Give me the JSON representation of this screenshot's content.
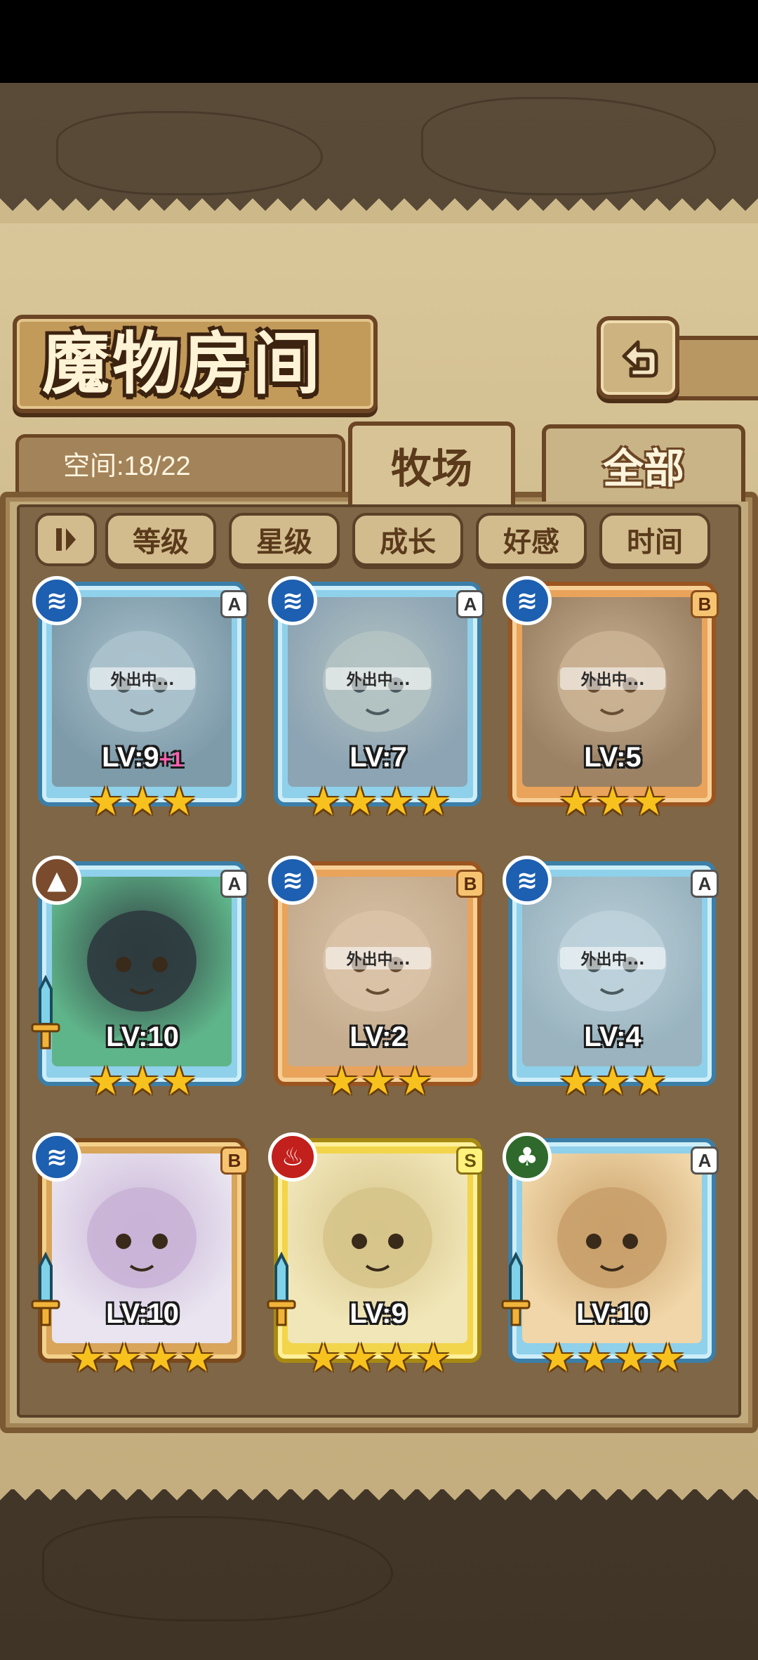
{
  "title": "魔物房间",
  "capacity": "空间:18/22",
  "tabs": {
    "active": "牧场",
    "inactive": "全部"
  },
  "sort_buttons": [
    "等级",
    "星级",
    "成长",
    "好感",
    "时间"
  ],
  "icons": {
    "back": "back-arrow-icon",
    "sort_toggle": "sort-order-icon"
  },
  "cards": [
    {
      "element": "water",
      "rank": "A",
      "level": "LV:9",
      "bonus": "+1",
      "stars": 3,
      "status": "外出中...",
      "weapon": false
    },
    {
      "element": "water",
      "rank": "A",
      "level": "LV:7",
      "bonus": "",
      "stars": 4,
      "status": "外出中...",
      "weapon": false
    },
    {
      "element": "water",
      "rank": "B",
      "level": "LV:5",
      "bonus": "",
      "stars": 3,
      "status": "外出中...",
      "weapon": false
    },
    {
      "element": "earth",
      "rank": "A",
      "level": "LV:10",
      "bonus": "",
      "stars": 3,
      "status": "",
      "weapon": true
    },
    {
      "element": "water",
      "rank": "B",
      "level": "LV:2",
      "bonus": "",
      "stars": 3,
      "status": "外出中...",
      "weapon": false
    },
    {
      "element": "water",
      "rank": "A",
      "level": "LV:4",
      "bonus": "",
      "stars": 3,
      "status": "外出中...",
      "weapon": false
    },
    {
      "element": "water",
      "rank": "B",
      "level": "LV:10",
      "bonus": "",
      "stars": 4,
      "status": "",
      "weapon": true
    },
    {
      "element": "fire",
      "rank": "S",
      "level": "LV:9",
      "bonus": "",
      "stars": 4,
      "status": "",
      "weapon": true
    },
    {
      "element": "wind",
      "rank": "A",
      "level": "LV:10",
      "bonus": "",
      "stars": 4,
      "status": "",
      "weapon": true
    }
  ]
}
